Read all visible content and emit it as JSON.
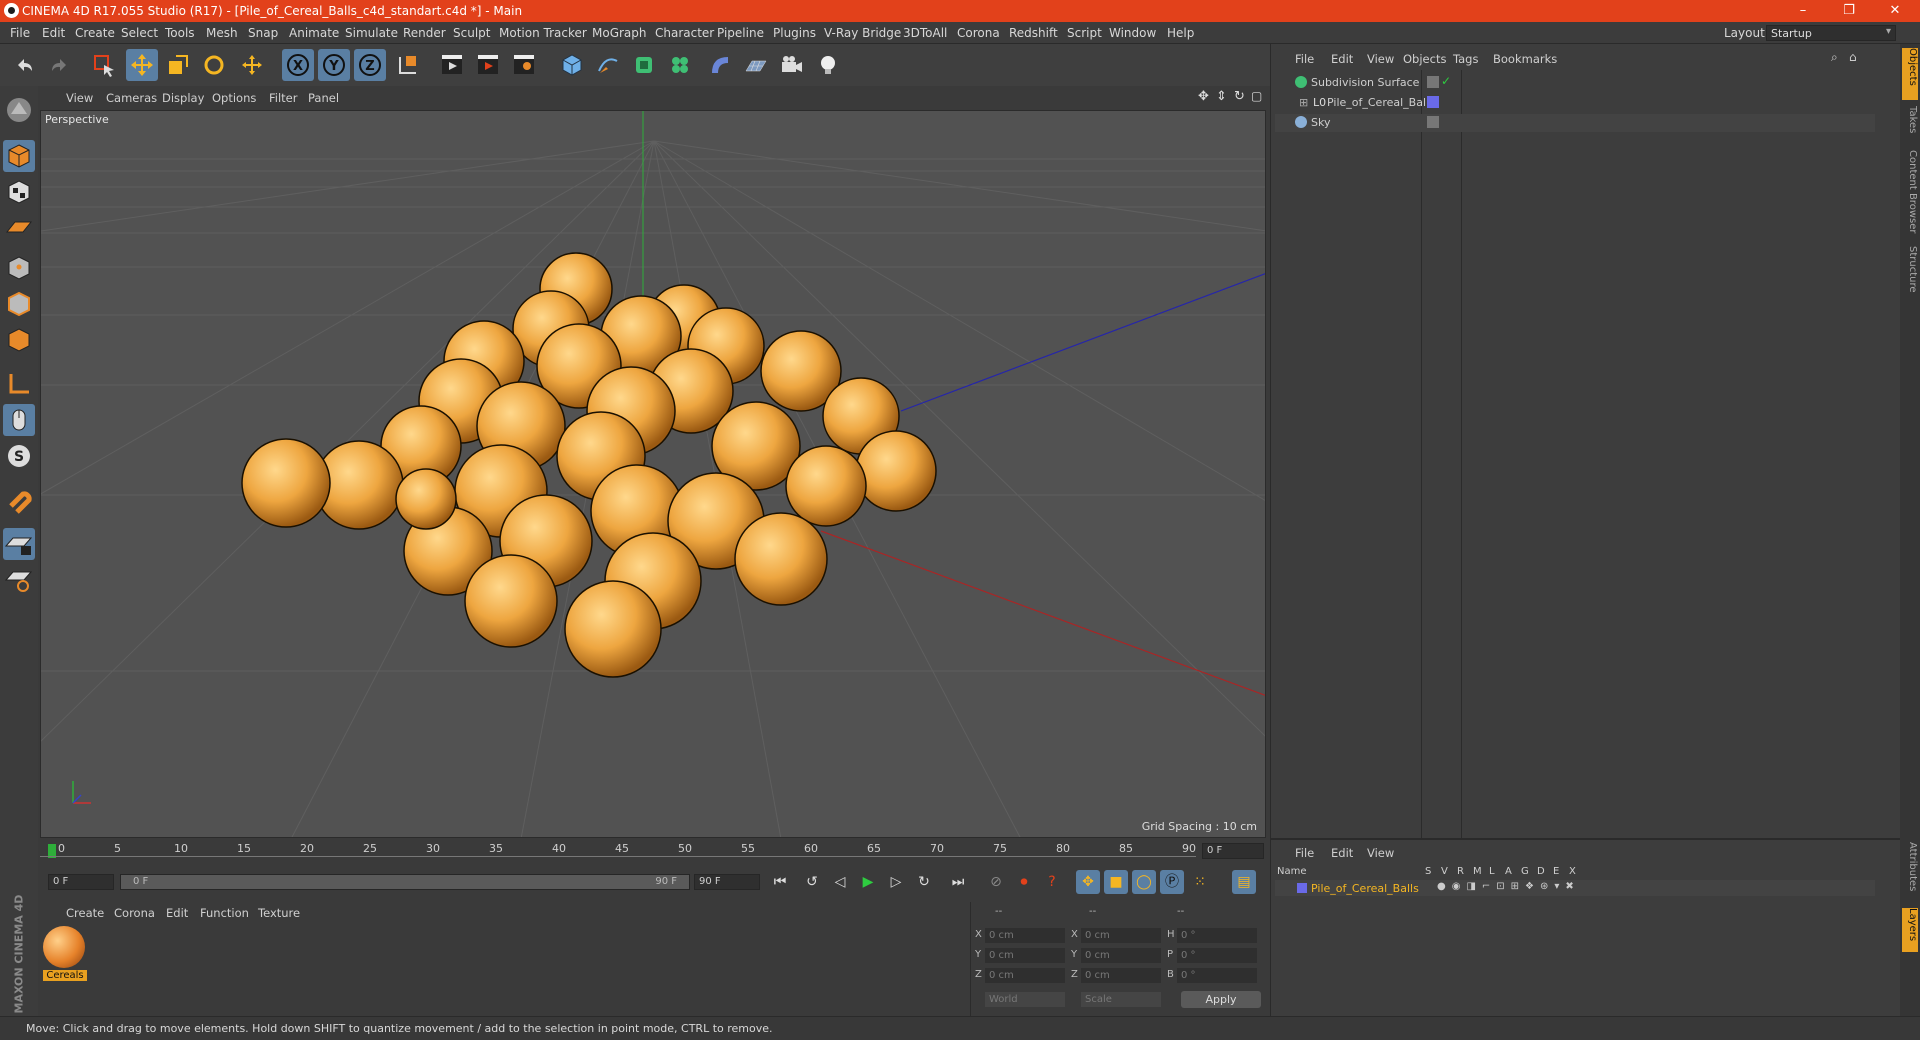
{
  "title_bar": {
    "title": "CINEMA 4D R17.055 Studio (R17) - [Pile_of_Cereal_Balls_c4d_standart.c4d *] - Main",
    "minimize": "–",
    "restore": "❐",
    "close": "✕"
  },
  "menu": [
    "File",
    "Edit",
    "Create",
    "Select",
    "Tools",
    "Mesh",
    "Snap",
    "Animate",
    "Simulate",
    "Render",
    "Sculpt",
    "Motion Tracker",
    "MoGraph",
    "Character",
    "Pipeline",
    "Plugins",
    "V-Ray Bridge",
    "3DToAll",
    "Corona",
    "Redshift",
    "Script",
    "Window",
    "Help"
  ],
  "layout": {
    "label": "Layout:",
    "value": "Startup"
  },
  "viewport": {
    "menu": [
      "View",
      "Cameras",
      "Display",
      "Options",
      "Filter",
      "Panel"
    ],
    "label": "Perspective",
    "grid_spacing": "Grid Spacing : 10 cm"
  },
  "timeline": {
    "ticks": [
      "0",
      "5",
      "10",
      "15",
      "20",
      "25",
      "30",
      "35",
      "40",
      "45",
      "50",
      "55",
      "60",
      "65",
      "70",
      "75",
      "80",
      "85",
      "90"
    ],
    "current_frame_field": "0 F",
    "start_field": "0 F",
    "range_start": "0 F",
    "range_end": "90 F",
    "end_field": "90 F"
  },
  "material_manager": {
    "menu": [
      "Create",
      "Corona",
      "Edit",
      "Function",
      "Texture"
    ],
    "material_name": "Cereals"
  },
  "coordinates": {
    "headers": [
      "--",
      "--",
      "--"
    ],
    "rows": [
      {
        "a": "X",
        "av": "0 cm",
        "b": "X",
        "bv": "0 cm",
        "c": "H",
        "cv": "0 °"
      },
      {
        "a": "Y",
        "av": "0 cm",
        "b": "Y",
        "bv": "0 cm",
        "c": "P",
        "cv": "0 °"
      },
      {
        "a": "Z",
        "av": "0 cm",
        "b": "Z",
        "bv": "0 cm",
        "c": "B",
        "cv": "0 °"
      }
    ],
    "world": "World",
    "scale": "Scale",
    "apply": "Apply"
  },
  "object_manager": {
    "menu": [
      "File",
      "Edit",
      "View",
      "Objects",
      "Tags",
      "Bookmarks"
    ],
    "objects": [
      "Subdivision Surface",
      "Pile_of_Cereal_Balls",
      "Sky"
    ]
  },
  "layer_manager": {
    "menu": [
      "File",
      "Edit",
      "View"
    ],
    "columns": [
      "Name",
      "S",
      "V",
      "R",
      "M",
      "L",
      "A",
      "G",
      "D",
      "E",
      "X"
    ],
    "layer_name": "Pile_of_Cereal_Balls"
  },
  "right_tabs": [
    "Objects",
    "Takes",
    "Content Browser",
    "Structure",
    "Attributes",
    "Layers"
  ],
  "brand": "MAXON CINEMA 4D",
  "status": "Move: Click and drag to move elements. Hold down SHIFT to quantize movement / add to the selection in point mode, CTRL to remove.",
  "colors": {
    "accent": "#e2411b",
    "highlight": "#5a7fa3",
    "material": "#e8a020"
  }
}
